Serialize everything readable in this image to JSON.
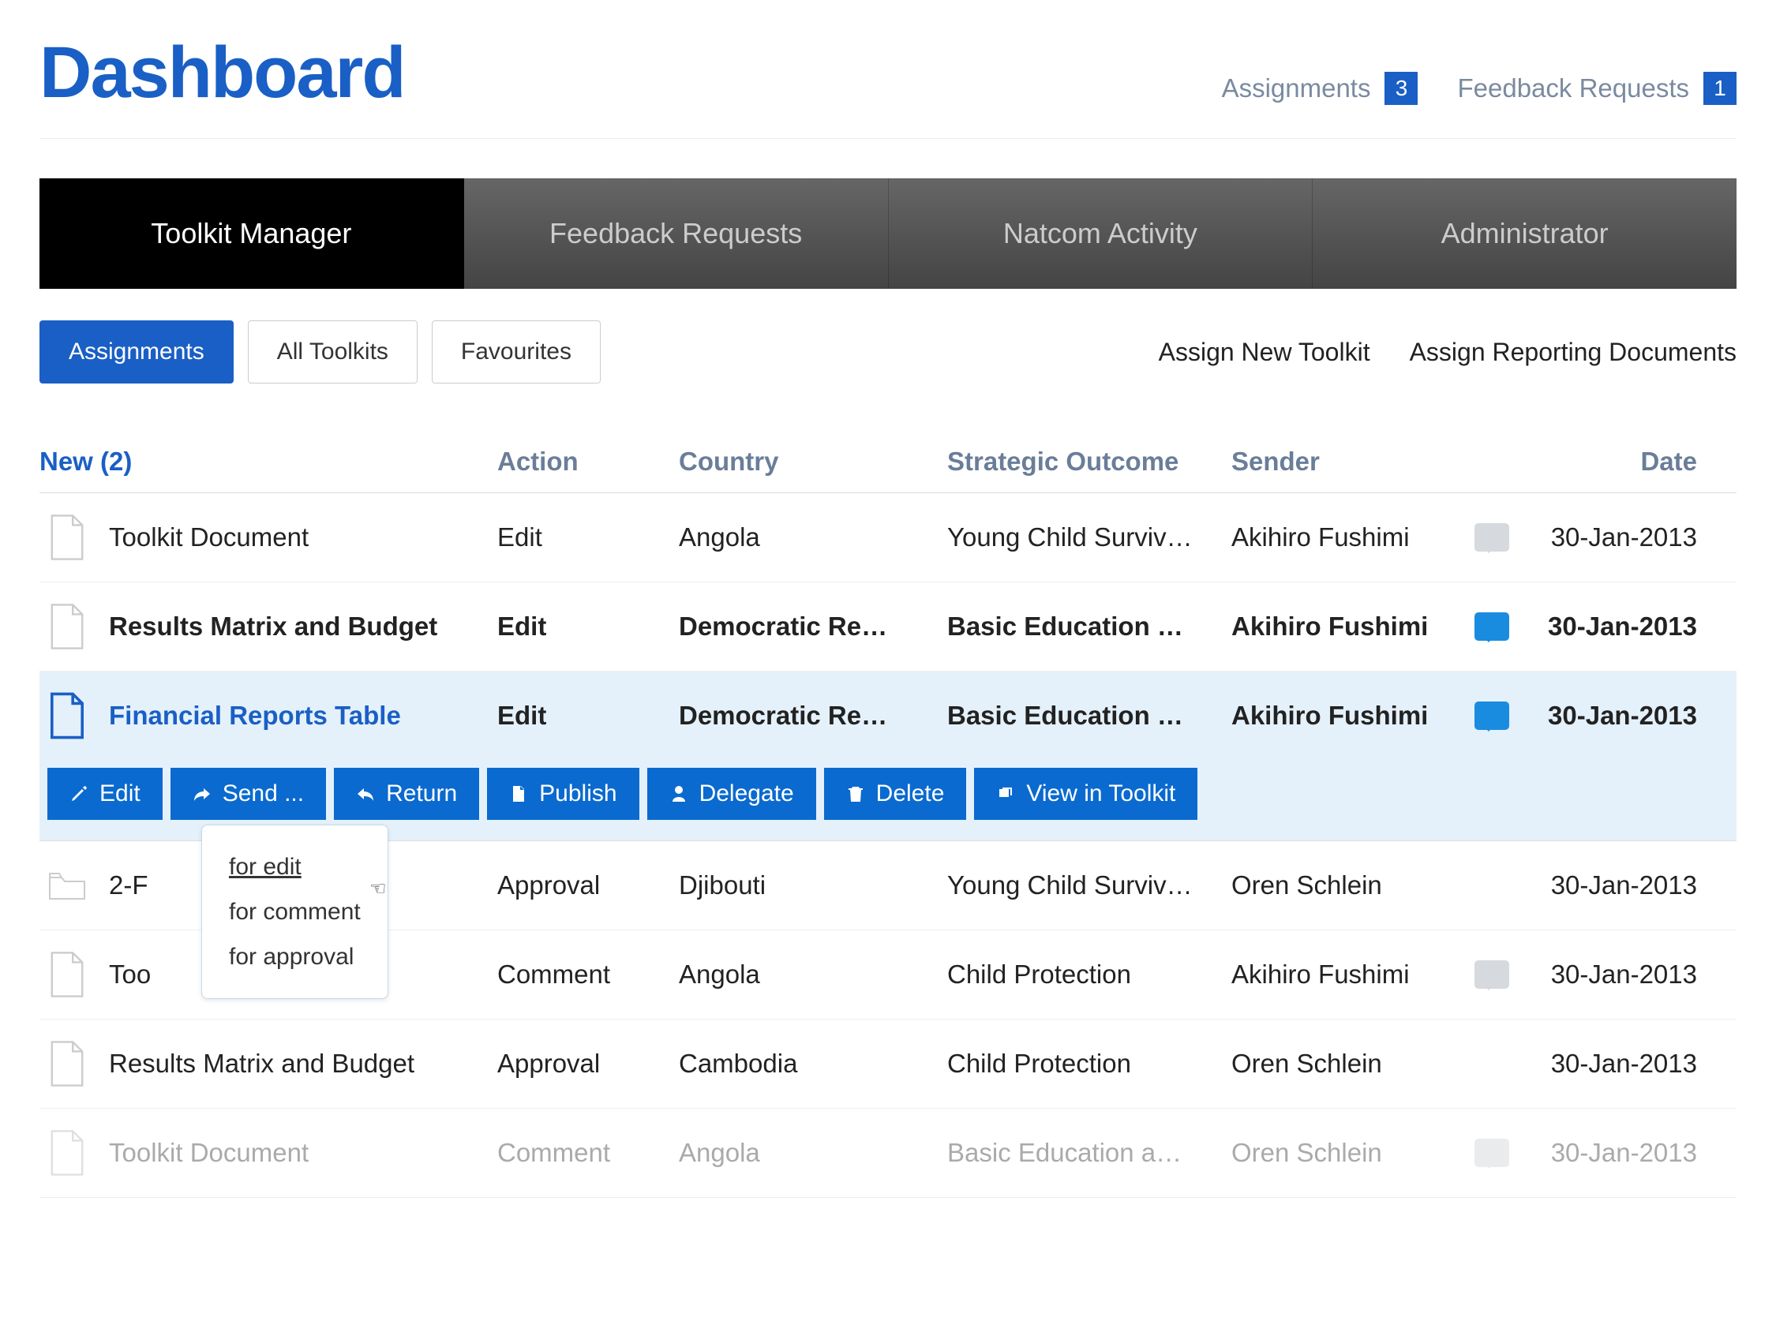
{
  "header": {
    "title": "Dashboard",
    "assignments_label": "Assignments",
    "assignments_count": "3",
    "feedback_label": "Feedback Requests",
    "feedback_count": "1"
  },
  "tabs": [
    {
      "label": "Toolkit Manager",
      "active": true
    },
    {
      "label": "Feedback Requests",
      "active": false
    },
    {
      "label": "Natcom Activity",
      "active": false
    },
    {
      "label": "Administrator",
      "active": false
    }
  ],
  "subtabs": [
    {
      "label": "Assignments",
      "active": true
    },
    {
      "label": "All Toolkits",
      "active": false
    },
    {
      "label": "Favourites",
      "active": false
    }
  ],
  "assign_links": {
    "new_toolkit": "Assign New Toolkit",
    "reporting_docs": "Assign Reporting Documents"
  },
  "columns": {
    "new": "New (2)",
    "action": "Action",
    "country": "Country",
    "outcome": "Strategic Outcome",
    "sender": "Sender",
    "date": "Date"
  },
  "rows": [
    {
      "icon": "doc",
      "name": "Toolkit Document",
      "action": "Edit",
      "country": "Angola",
      "outcome": "Young Child Surviv…",
      "sender": "Akihiro Fushimi",
      "comment": "grey",
      "date": "30-Jan-2013",
      "style": "normal"
    },
    {
      "icon": "doc",
      "name": "Results Matrix and Budget",
      "action": "Edit",
      "country": "Democratic Re…",
      "outcome": "Basic Education …",
      "sender": "Akihiro Fushimi",
      "comment": "blue",
      "date": "30-Jan-2013",
      "style": "bold"
    },
    {
      "icon": "doc",
      "name": "Financial Reports Table",
      "action": "Edit",
      "country": "Democratic Re…",
      "outcome": "Basic Education …",
      "sender": "Akihiro Fushimi",
      "comment": "blue",
      "date": "30-Jan-2013",
      "style": "selected"
    },
    {
      "icon": "folder",
      "name": "2-F",
      "action": "Approval",
      "country": "Djibouti",
      "outcome": "Young Child Surviv…",
      "sender": "Oren Schlein",
      "comment": "",
      "date": "30-Jan-2013",
      "style": "normal"
    },
    {
      "icon": "doc",
      "name": "Too",
      "action": "Comment",
      "country": "Angola",
      "outcome": "Child Protection",
      "sender": "Akihiro Fushimi",
      "comment": "grey",
      "date": "30-Jan-2013",
      "style": "normal"
    },
    {
      "icon": "doc",
      "name": "Results Matrix and Budget",
      "action": "Approval",
      "country": "Cambodia",
      "outcome": "Child Protection",
      "sender": "Oren Schlein",
      "comment": "",
      "date": "30-Jan-2013",
      "style": "normal"
    },
    {
      "icon": "doc",
      "name": "Toolkit Document",
      "action": "Comment",
      "country": "Angola",
      "outcome": "Basic Education a…",
      "sender": "Oren Schlein",
      "comment": "grey",
      "date": "30-Jan-2013",
      "style": "greyed"
    }
  ],
  "action_buttons": [
    {
      "icon": "pencil",
      "label": "Edit"
    },
    {
      "icon": "forward",
      "label": "Send ..."
    },
    {
      "icon": "back",
      "label": "Return"
    },
    {
      "icon": "file",
      "label": "Publish"
    },
    {
      "icon": "user",
      "label": "Delegate"
    },
    {
      "icon": "trash",
      "label": "Delete"
    },
    {
      "icon": "view",
      "label": "View in Toolkit"
    }
  ],
  "send_dropdown": {
    "for_edit": "for edit",
    "for_comment": "for comment",
    "for_approval": "for approval"
  }
}
